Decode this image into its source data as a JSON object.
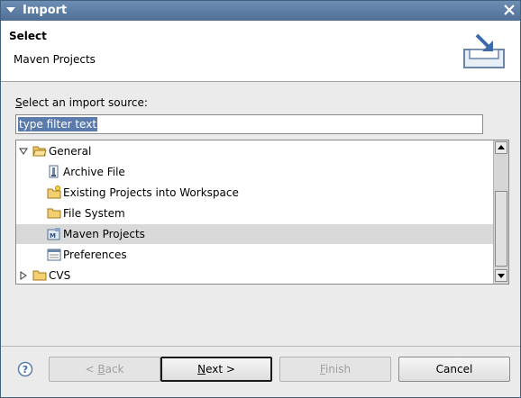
{
  "window": {
    "title": "Import"
  },
  "banner": {
    "heading": "Select",
    "description": "Maven Projects"
  },
  "source_label": {
    "mnemonic": "S",
    "rest": "elect an import source:"
  },
  "filter": {
    "value": "type filter text"
  },
  "tree": {
    "selected_index": 4,
    "rows": [
      {
        "label": "General",
        "level": 0,
        "expanded": true,
        "icon": "folder-open-icon"
      },
      {
        "label": "Archive File",
        "level": 1,
        "icon": "archive-file-icon"
      },
      {
        "label": "Existing Projects into Workspace",
        "level": 1,
        "icon": "existing-projects-icon"
      },
      {
        "label": "File System",
        "level": 1,
        "icon": "folder-icon"
      },
      {
        "label": "Maven Projects",
        "level": 1,
        "icon": "maven-projects-icon"
      },
      {
        "label": "Preferences",
        "level": 1,
        "icon": "preferences-icon"
      },
      {
        "label": "CVS",
        "level": 0,
        "expanded": false,
        "icon": "folder-icon"
      }
    ]
  },
  "buttons": {
    "back": {
      "mnemonic": "B",
      "pre": "< ",
      "post": "ack",
      "enabled": false
    },
    "next": {
      "mnemonic": "N",
      "pre": "",
      "post": "ext >",
      "enabled": true
    },
    "finish": {
      "mnemonic": "F",
      "pre": "",
      "post": "inish",
      "enabled": false
    },
    "cancel": {
      "label": "Cancel",
      "enabled": true
    }
  },
  "colors": {
    "titlebar": "#5a7aa2",
    "selection": "#5a7bab",
    "row_selected": "#d9d9d9"
  }
}
